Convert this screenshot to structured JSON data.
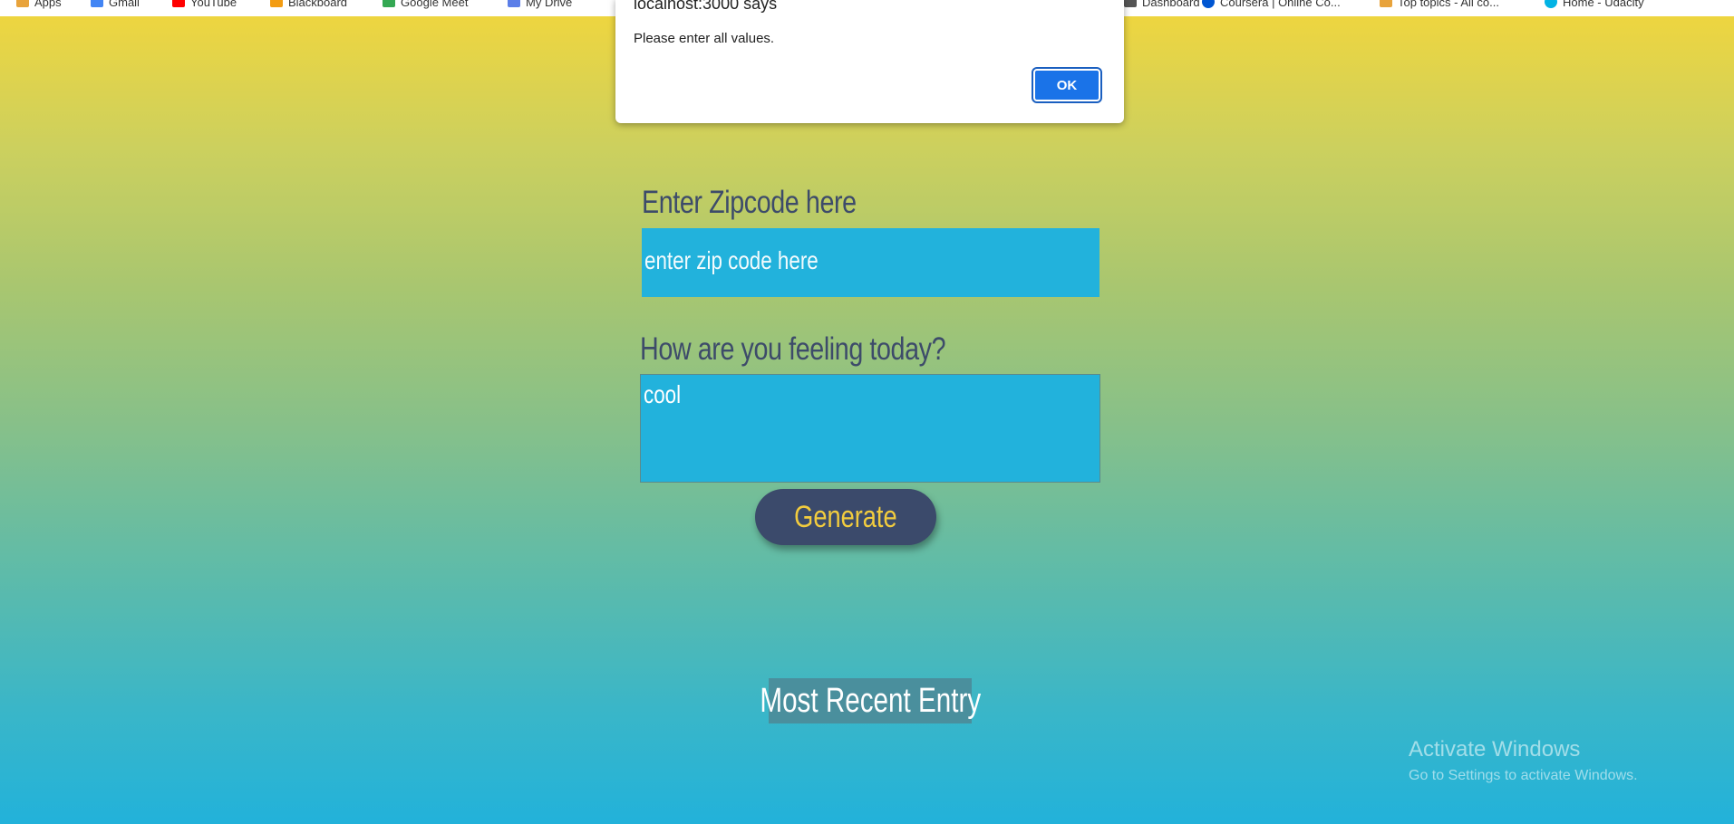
{
  "bookmarks_bar": {
    "items": [
      {
        "label": "Apps",
        "icon": "apps-grid-icon",
        "color": "#e8a33b"
      },
      {
        "label": "Gmail",
        "icon": "gmail-icon",
        "color": "#4285f4"
      },
      {
        "label": "YouTube",
        "icon": "youtube-icon",
        "color": "#ff0000"
      },
      {
        "label": "Blackboard",
        "icon": "blackboard-icon",
        "color": "#f39c12"
      },
      {
        "label": "Google Meet",
        "icon": "google-meet-icon",
        "color": "#34a853"
      },
      {
        "label": "My Drive",
        "icon": "drive-icon",
        "color": "#5b7ee8"
      },
      {
        "label": "Dashboard",
        "icon": "dashboard-icon",
        "color": "#555555"
      },
      {
        "label": "Coursera | Online Co...",
        "icon": "coursera-icon",
        "color": "#0056d2"
      },
      {
        "label": "Top topics - All co...",
        "icon": "topics-icon",
        "color": "#e8a33b"
      },
      {
        "label": "Home - Udacity",
        "icon": "udacity-icon",
        "color": "#02b3e4"
      }
    ]
  },
  "dialog": {
    "title": "localhost:3000 says",
    "message": "Please enter all values.",
    "ok_label": "OK"
  },
  "form": {
    "zip_label": "Enter Zipcode here",
    "zip_placeholder": "enter zip code here",
    "feelings_label": "How are you feeling today?",
    "feelings_value": "cool",
    "generate_label": "Generate"
  },
  "recent": {
    "title": "Most Recent Entry"
  },
  "watermark": {
    "line1": "Activate Windows",
    "line2": "Go to Settings to activate Windows."
  },
  "colors": {
    "input_bg": "#22b2dc",
    "label_text": "#3d4b6a",
    "button_bg": "#3b4a6b",
    "button_text": "#f2cc3e",
    "dialog_ok": "#1a73e8"
  }
}
